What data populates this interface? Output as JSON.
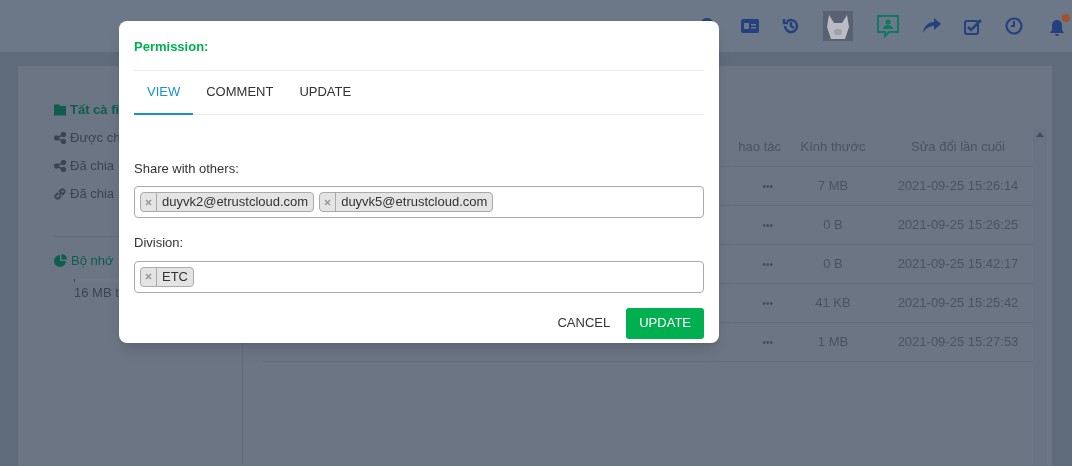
{
  "sidebar": {
    "items": [
      {
        "label": "Tất cà fi",
        "kind": "folder",
        "selected": true
      },
      {
        "label": "Được ch",
        "kind": "share",
        "selected": false
      },
      {
        "label": "Đã chia",
        "kind": "share",
        "selected": false
      },
      {
        "label": "Đã chia",
        "kind": "link",
        "selected": false
      }
    ],
    "storage": {
      "label": "Bộ nhớ",
      "level": 0.01,
      "usage": "16 MB t"
    }
  },
  "table": {
    "columns": [
      "hao tác",
      "Kính thước",
      "Sửa đổi lần cuối"
    ],
    "rows": [
      {
        "actions": "•••",
        "size": "7 MB",
        "modified": "2021-09-25 15:26:14"
      },
      {
        "actions": "•••",
        "size": "0 B",
        "modified": "2021-09-25 15:26:25"
      },
      {
        "actions": "•••",
        "size": "0 B",
        "modified": "2021-09-25 15:42:17"
      },
      {
        "actions": "•••",
        "size": "41 KB",
        "modified": "2021-09-25 15:25:42"
      },
      {
        "actions": "•••",
        "size": "1 MB",
        "modified": "2021-09-25 15:27:53"
      }
    ]
  },
  "dialog": {
    "title": "Permission:",
    "tabs": [
      {
        "label": "VIEW",
        "selected": true
      },
      {
        "label": "COMMENT",
        "selected": false
      },
      {
        "label": "UPDATE",
        "selected": false
      }
    ],
    "fields": [
      {
        "label": "Share with others:",
        "tags": [
          "duyvk2@etrustcloud.com",
          "duyvk5@etrustcloud.com"
        ]
      },
      {
        "label": "Division:",
        "tags": [
          "ETC"
        ]
      }
    ],
    "buttons": [
      {
        "label": "CANCEL",
        "kind": "secondary"
      },
      {
        "label": "UPDATE",
        "kind": "primary"
      }
    ]
  }
}
